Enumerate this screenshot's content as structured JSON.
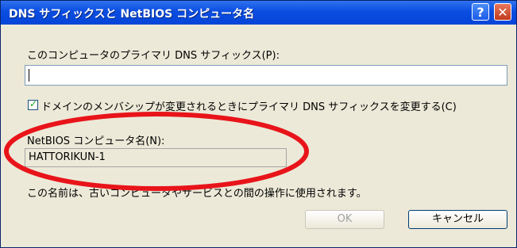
{
  "window": {
    "title": "DNS サフィックスと NetBIOS コンピュータ名"
  },
  "titlebar_buttons": {
    "help": "?",
    "close": "✕"
  },
  "primary_dns": {
    "label": "このコンピュータのプライマリ DNS サフィックス(P):",
    "value": ""
  },
  "change_checkbox": {
    "checked": true,
    "label": "ドメインのメンバシップが変更されるときにプライマリ DNS サフィックスを変更する(C)"
  },
  "netbios": {
    "label": "NetBIOS コンピュータ名(N):",
    "value": "HATTORIKUN-1"
  },
  "note": "この名前は、古いコンピュータやサービスとの間の操作に使用されます。",
  "buttons": {
    "ok": "OK",
    "cancel": "キャンセル"
  },
  "colors": {
    "annotation": "#e8141a",
    "titlebar": "#0b4de1"
  }
}
